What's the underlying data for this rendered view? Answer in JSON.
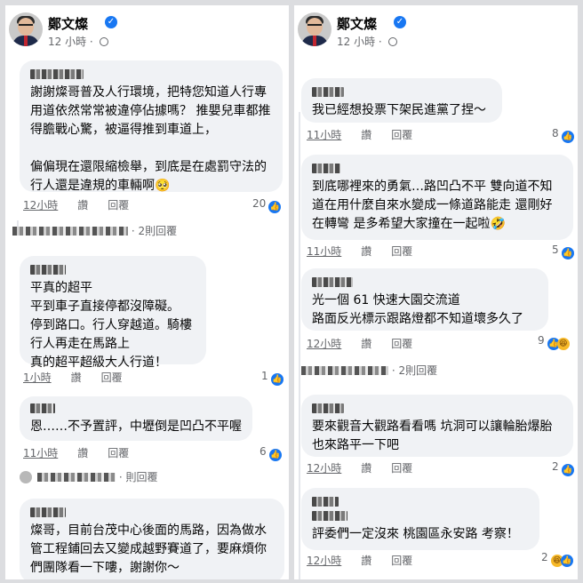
{
  "post": {
    "author": "鄭文燦",
    "timestamp": "12 小時",
    "icons": {
      "verified": "verified-check-icon",
      "audience": "globe-icon"
    }
  },
  "actions": {
    "like": "讚",
    "reply": "回覆"
  },
  "left": {
    "comments": [
      {
        "text": "謝謝燦哥普及人行環境，把特您知道人行專\n用道依然常常被違停佔據嗎？ 推嬰兒車都推\n得膽戰心驚，被逼得推到車道上，\n\n偏偏現在還限縮檢舉，到底是在處罰守法的\n行人還是違規的車輛啊🥺",
        "time": "12小時",
        "count": "20",
        "replies": "2則回覆"
      },
      {
        "text": "平真的超平\n平到車子直接停都沒障礙。\n停到路口。行人穿越道。騎樓\n行人再走在馬路上\n真的超平超級大人行道！",
        "time": "1小時",
        "count": "1",
        "replies": ""
      },
      {
        "text": "恩……不予置評，中壢倒是凹凸不平喔",
        "time": "11小時",
        "count": "6",
        "replies": "則回覆"
      },
      {
        "text": "燦哥，目前台茂中心後面的馬路，因為做水\n管工程鋪回去又變成越野賽道了，要麻煩你\n們團隊看一下嘍，謝謝你～",
        "time": "",
        "count": "",
        "replies": ""
      }
    ]
  },
  "right": {
    "comments": [
      {
        "text": "我已經想投票下架民進黨了捏～",
        "time": "11小時",
        "count": "8",
        "replies": ""
      },
      {
        "text": "到底哪裡來的勇氣…路凹凸不平 雙向道不知\n道在用什麼自來水變成一條道路能走 還剛好\n在轉彎 是多希望大家撞在一起啦🤣",
        "time": "11小時",
        "count": "5",
        "replies": ""
      },
      {
        "text": "光一個 61 快速大園交流道\n路面反光標示跟路燈都不知道壞多久了",
        "time": "12小時",
        "count": "9",
        "replies": "2則回覆"
      },
      {
        "text": "要來觀音大觀路看看嗎 坑洞可以讓輪胎爆胎\n也來路平一下吧",
        "time": "12小時",
        "count": "2",
        "replies": ""
      },
      {
        "text": "評委們一定沒來 桃園區永安路 考察！",
        "time": "12小時",
        "count": "2",
        "replies": ""
      }
    ]
  }
}
